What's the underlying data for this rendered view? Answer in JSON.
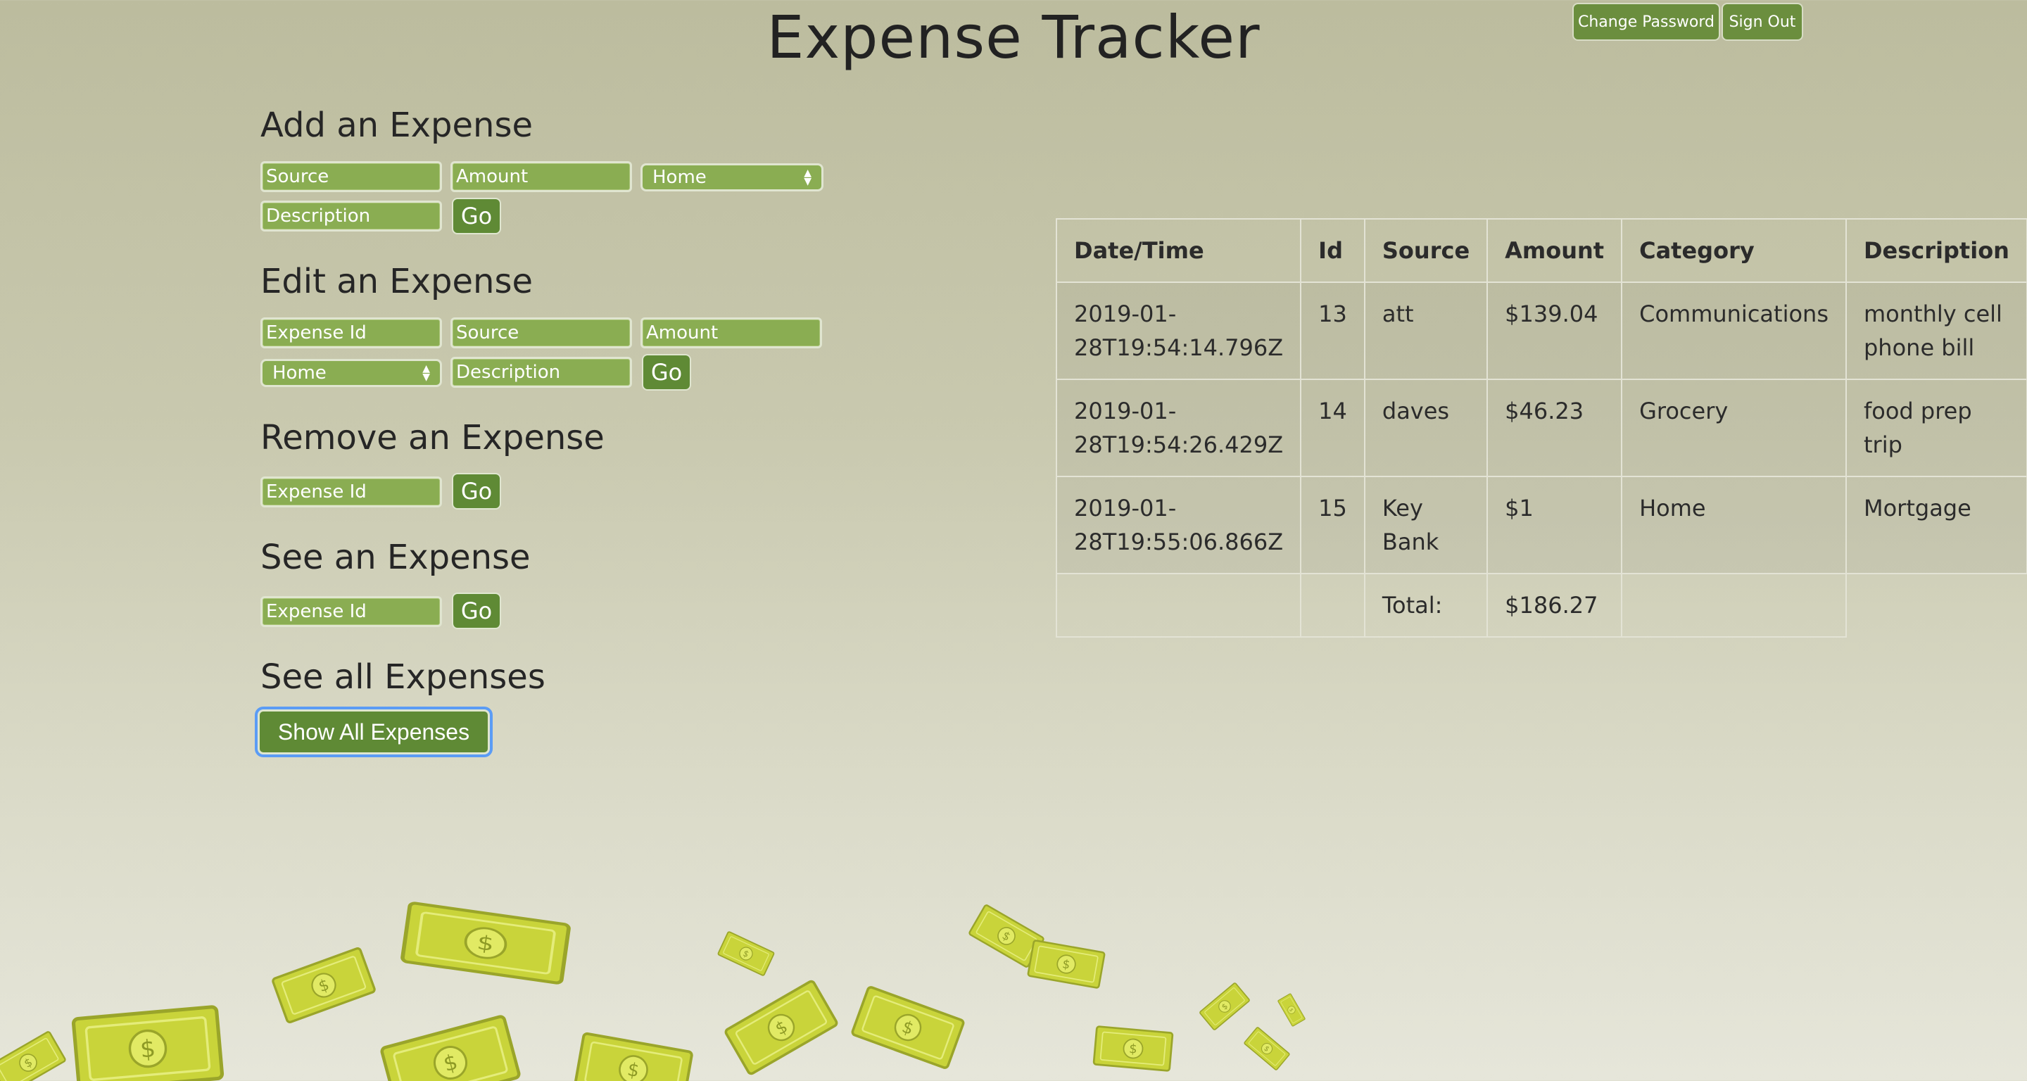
{
  "app": {
    "title": "Expense Tracker"
  },
  "header": {
    "change_password": "Change Password",
    "sign_out": "Sign Out"
  },
  "add": {
    "title": "Add an Expense",
    "source_placeholder": "Source",
    "amount_placeholder": "Amount",
    "category_value": "Home",
    "description_placeholder": "Description",
    "go": "Go"
  },
  "edit": {
    "title": "Edit an Expense",
    "id_placeholder": "Expense Id",
    "source_placeholder": "Source",
    "amount_placeholder": "Amount",
    "category_value": "Home",
    "description_placeholder": "Description",
    "go": "Go"
  },
  "remove": {
    "title": "Remove an Expense",
    "id_placeholder": "Expense Id",
    "go": "Go"
  },
  "see": {
    "title": "See an Expense",
    "id_placeholder": "Expense Id",
    "go": "Go"
  },
  "see_all": {
    "title": "See all Expenses",
    "button": "Show All Expenses"
  },
  "table": {
    "headers": [
      "Date/Time",
      "Id",
      "Source",
      "Amount",
      "Category",
      "Description"
    ],
    "rows": [
      {
        "datetime": "2019-01-28T19:54:14.796Z",
        "id": "13",
        "source": "att",
        "amount": "$139.04",
        "category": "Communications",
        "description": "monthly cell phone bill"
      },
      {
        "datetime": "2019-01-28T19:54:26.429Z",
        "id": "14",
        "source": "daves",
        "amount": "$46.23",
        "category": "Grocery",
        "description": "food prep trip"
      },
      {
        "datetime": "2019-01-28T19:55:06.866Z",
        "id": "15",
        "source": "Key Bank",
        "amount": "$1",
        "category": "Home",
        "description": "Mortgage"
      }
    ],
    "total_label": "Total:",
    "total_value": "$186.27"
  },
  "icons": {
    "select_arrow": "updown-arrows-icon",
    "bill": "dollar-bill-icon"
  },
  "colors": {
    "button": "#5f8a35",
    "field": "#8aad52",
    "focus": "#5b9cf5",
    "bill": "#c9d43a"
  }
}
